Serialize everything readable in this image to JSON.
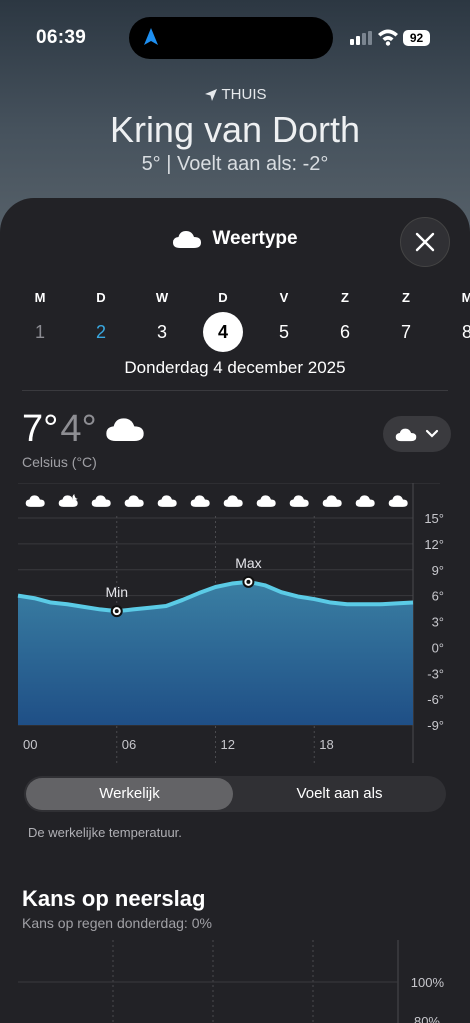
{
  "status": {
    "time": "06:39",
    "battery": "92"
  },
  "location": {
    "label": "THUIS",
    "city": "Kring van Dorth",
    "summary": "5°  |  Voelt aan als: -2°"
  },
  "sheet": {
    "title": "Weertype"
  },
  "week": {
    "letters": [
      "M",
      "D",
      "W",
      "D",
      "V",
      "Z",
      "Z",
      "M"
    ],
    "numbers": [
      "1",
      "2",
      "3",
      "4",
      "5",
      "6",
      "7",
      "8"
    ],
    "today_index": 1,
    "selected_index": 3
  },
  "selected_date": "Donderdag 4 december 2025",
  "summary_temps": {
    "high": "7°",
    "low": "4°",
    "unit": "Celsius (°C)"
  },
  "chart_data": {
    "type": "area",
    "x": [
      0,
      1,
      2,
      3,
      4,
      5,
      6,
      7,
      8,
      9,
      10,
      11,
      12,
      13,
      14,
      15,
      16,
      17,
      18,
      19,
      20,
      21,
      22,
      23,
      24
    ],
    "values": [
      6.0,
      5.7,
      5.2,
      5.0,
      4.7,
      4.4,
      4.2,
      4.4,
      4.6,
      4.8,
      5.5,
      6.3,
      7.0,
      7.4,
      7.6,
      7.2,
      6.4,
      5.9,
      5.6,
      5.2,
      5.0,
      5.0,
      5.0,
      5.1,
      5.2
    ],
    "ylim": [
      -9,
      15
    ],
    "y_ticks": [
      "15°",
      "12°",
      "9°",
      "6°",
      "3°",
      "0°",
      "-3°",
      "-6°",
      "-9°"
    ],
    "x_ticks": [
      "00",
      "06",
      "12",
      "18"
    ],
    "annotations": [
      {
        "label": "Min",
        "x": 6,
        "y": 4.2
      },
      {
        "label": "Max",
        "x": 14,
        "y": 7.6
      }
    ],
    "condition_icons": [
      "cloud-icon",
      "cloud-moon-icon",
      "cloud-icon",
      "cloud-icon",
      "cloud-icon",
      "cloud-icon",
      "cloud-icon",
      "cloud-icon",
      "cloud-icon",
      "cloud-icon",
      "cloud-icon",
      "cloud-icon"
    ],
    "colors": {
      "line": "#5bcbe6",
      "fill_top": "#3a7fa3",
      "fill_bottom": "#1f4f86"
    }
  },
  "segment": {
    "option_a": "Werkelijk",
    "option_b": "Voelt aan als",
    "description": "De werkelijke temperatuur."
  },
  "precip": {
    "title": "Kans op neerslag",
    "subtitle": "Kans op regen donderdag: 0%",
    "y_ticks": [
      "100%",
      "80%"
    ]
  }
}
